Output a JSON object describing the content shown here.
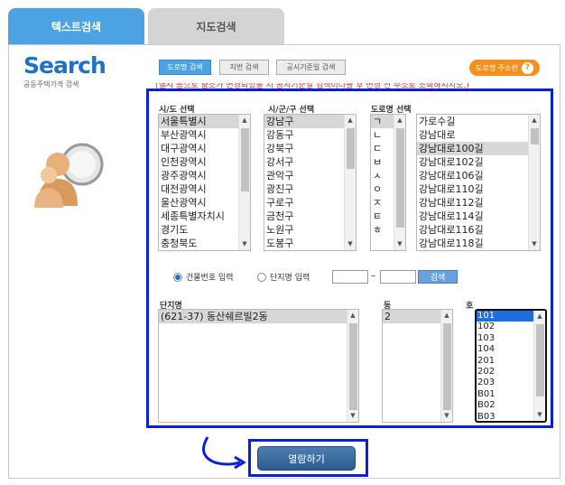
{
  "tabs": {
    "text_search": "텍스트검색",
    "map_search": "지도검색"
  },
  "logo": {
    "title": "Search",
    "subtitle": "공동주택가격 검색"
  },
  "buttons": {
    "road_name": "도로명 검색",
    "lot_number": "지번 검색",
    "notice_standard": "공시기준일 검색",
    "road_address_help": "도로명 주소란"
  },
  "notice_text": "(열시 등으로 중소가 변경되었을 시 공시기준일 검색이나를 후 변경 전 주소로 조회하시시오.)",
  "headers": {
    "sido": "시/도 선택",
    "sigungu": "시/군/구 선택",
    "road": "도로명 선택",
    "complex": "단지명",
    "dong": "동",
    "ho": "호"
  },
  "sido_list": [
    "서울특별시",
    "부산광역시",
    "대구광역시",
    "인천광역시",
    "광주광역시",
    "대전광역시",
    "울산광역시",
    "세종특별자치시",
    "경기도",
    "충청북도"
  ],
  "sigungu_list": [
    "강남구",
    "강동구",
    "강북구",
    "강서구",
    "관악구",
    "광진구",
    "구로구",
    "금천구",
    "노원구",
    "도봉구"
  ],
  "initial_list": [
    "ㄱ",
    "ㄴ",
    "ㄷ",
    "ㅂ",
    "ㅅ",
    "ㅇ",
    "ㅈ",
    "ㅌ",
    "ㅎ"
  ],
  "road_list": [
    "가로수길",
    "강남대로",
    "강남대로100길",
    "강남대로102길",
    "강남대로106길",
    "강남대로110길",
    "강남대로112길",
    "강남대로114길",
    "강남대로116길",
    "강남대로118길"
  ],
  "radio": {
    "building_no": "건물번호 입력",
    "complex_name": "단지명 입력"
  },
  "input_separator": "–",
  "search_button": "검색",
  "complex_list": [
    "(621-37) 동산쉐르빌2동"
  ],
  "dong_list": [
    "2"
  ],
  "ho_list": [
    "101",
    "102",
    "103",
    "104",
    "201",
    "202",
    "203",
    "B01",
    "B02",
    "B03"
  ],
  "view_button": "열람하기",
  "colors": {
    "tab_active": "#4ba3e3",
    "highlight_border": "#0a1fdc",
    "help_button": "#f4901e",
    "selected_ho": "#1e6fdc"
  }
}
